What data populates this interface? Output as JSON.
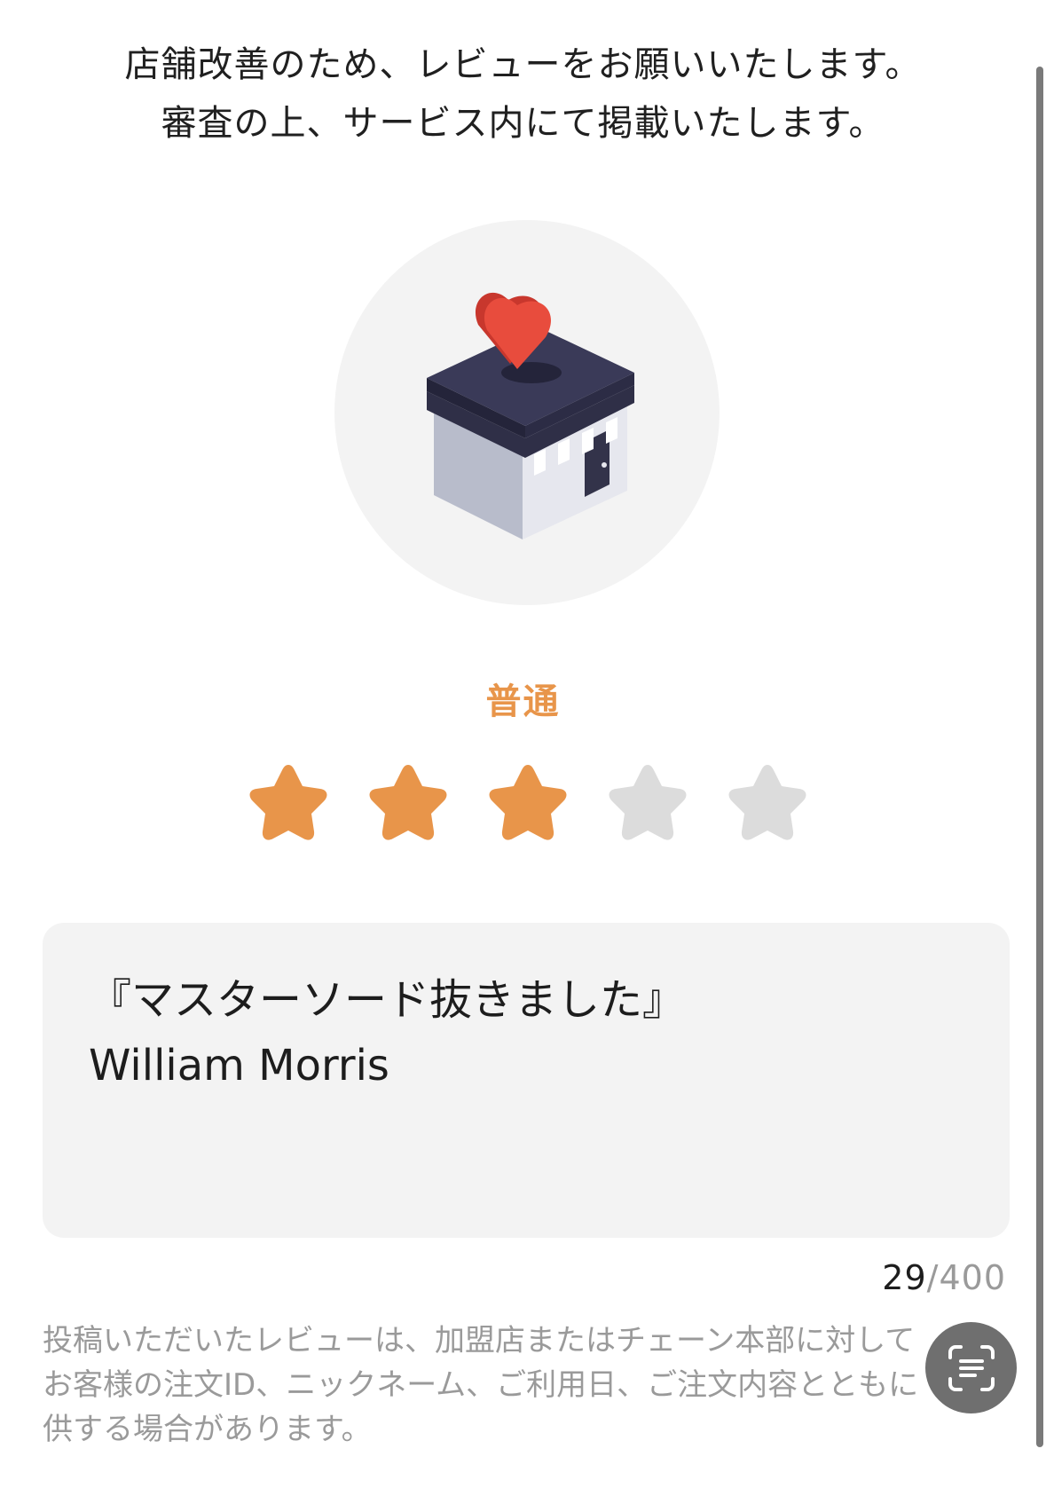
{
  "intro": {
    "line1": "店舗改善のため、レビューをお願いいたします。",
    "line2": "審査の上、サービス内にて掲載いたします。"
  },
  "hero": {
    "icon": "shop-with-heart-icon"
  },
  "rating": {
    "label": "普通",
    "value": 3,
    "max": 5,
    "active_color": "#e8954a",
    "inactive_color": "#dcdcdc"
  },
  "review": {
    "text": "『マスターソード抜きました』\nWilliam Morris"
  },
  "counter": {
    "current": "29",
    "separator": "/",
    "max": "400"
  },
  "notice": {
    "line1": "投稿いただいたレビューは、加盟店またはチェーン本部に対して",
    "line2": "お客様の注文ID、ニックネーム、ご利用日、ご注文内容とともに",
    "line3": "供する場合があります。"
  },
  "scan_button": {
    "icon": "text-scan-icon"
  }
}
